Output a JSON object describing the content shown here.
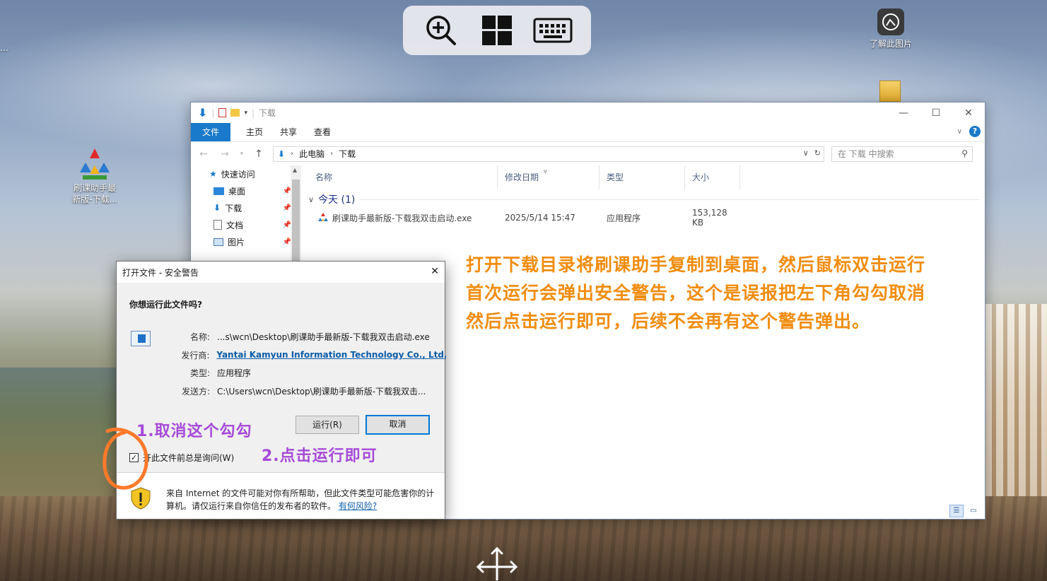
{
  "desktop": {
    "corner_text": "…",
    "about_label": "了解此图片",
    "desktop_app_label_line1": "刷课助手最",
    "desktop_app_label_line2": "新版-下载..."
  },
  "floating_toolbar": {
    "icons": [
      "zoom-in-icon",
      "windows-icon",
      "keyboard-icon"
    ]
  },
  "explorer": {
    "title": "下载",
    "tabs": [
      "文件",
      "主页",
      "共享",
      "查看"
    ],
    "address": {
      "root": "此电脑",
      "current": "下载"
    },
    "search_placeholder": "在 下载 中搜索",
    "nav": {
      "quick_access": "快速访问",
      "items": [
        "桌面",
        "下载",
        "文档",
        "图片"
      ]
    },
    "columns": [
      "名称",
      "修改日期",
      "类型",
      "大小"
    ],
    "group": "今天 (1)",
    "files": [
      {
        "name": "刷课助手最新版-下载我双击启动.exe",
        "date": "2025/5/14 15:47",
        "type": "应用程序",
        "size": "153,128 KB"
      }
    ],
    "instruction_lines": [
      "打开下载目录将刷课助手复制到桌面，然后鼠标双击运行",
      "首次运行会弹出安全警告，这个是误报把左下角勾勾取消",
      "然后点击运行即可，后续不会再有这个警告弹出。"
    ]
  },
  "dialog": {
    "title": "打开文件 - 安全警告",
    "question": "你想运行此文件吗?",
    "labels": {
      "name": "名称:",
      "publisher": "发行商:",
      "type": "类型:",
      "from": "发送方:"
    },
    "values": {
      "name": "...s\\wcn\\Desktop\\刷课助手最新版-下载我双击启动.exe",
      "publisher": "Yantai Kamyun Information Technology Co., Ltd.",
      "type": "应用程序",
      "from": "C:\\Users\\wcn\\Desktop\\刷课助手最新版-下载我双击..."
    },
    "run_button": "运行(R)",
    "cancel_button": "取消",
    "checkbox_label": "开此文件前总是询问(W)",
    "checkbox_checked": true,
    "footer_text": "来自 Internet 的文件可能对你有所帮助，但此文件类型可能危害你的计算机。请仅运行来自你信任的发布者的软件。",
    "footer_link": "有何风险?"
  },
  "annotations": {
    "step1": "1.取消这个勾勾",
    "step2": "2.点击运行即可"
  },
  "colors": {
    "accent_blue": "#1979ca",
    "instruction_orange": "#f08d10",
    "annotation_purple": "#a64ad8",
    "annotation_circle": "#ff7a2a"
  }
}
